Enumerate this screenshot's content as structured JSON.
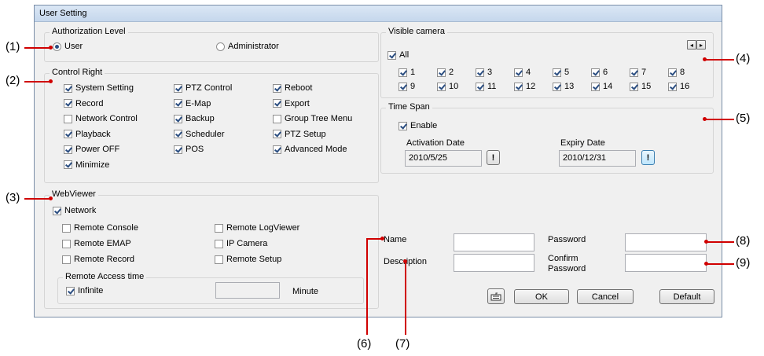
{
  "window": {
    "title": "User Setting"
  },
  "authorization": {
    "title": "Authorization Level",
    "options": [
      {
        "label": "User",
        "selected": true
      },
      {
        "label": "Administrator",
        "selected": false
      }
    ]
  },
  "control_right": {
    "title": "Control Right",
    "items": [
      {
        "label": "System Setting",
        "checked": true
      },
      {
        "label": "PTZ Control",
        "checked": true
      },
      {
        "label": "Reboot",
        "checked": true
      },
      {
        "label": "Record",
        "checked": true
      },
      {
        "label": "E-Map",
        "checked": true
      },
      {
        "label": "Export",
        "checked": true
      },
      {
        "label": "Network Control",
        "checked": false
      },
      {
        "label": "Backup",
        "checked": true
      },
      {
        "label": "Group Tree Menu",
        "checked": false
      },
      {
        "label": "Playback",
        "checked": true
      },
      {
        "label": "Scheduler",
        "checked": true
      },
      {
        "label": "PTZ Setup",
        "checked": true
      },
      {
        "label": "Power OFF",
        "checked": true
      },
      {
        "label": "POS",
        "checked": true
      },
      {
        "label": "Advanced Mode",
        "checked": true
      },
      {
        "label": "Minimize",
        "checked": true
      }
    ]
  },
  "webviewer": {
    "title": "WebViewer",
    "network": {
      "label": "Network",
      "checked": true
    },
    "items": [
      {
        "label": "Remote Console",
        "checked": false
      },
      {
        "label": "Remote LogViewer",
        "checked": false
      },
      {
        "label": "Remote EMAP",
        "checked": false
      },
      {
        "label": "IP Camera",
        "checked": false
      },
      {
        "label": "Remote Record",
        "checked": false
      },
      {
        "label": "Remote Setup",
        "checked": false
      }
    ],
    "access_time": {
      "title": "Remote Access time",
      "infinite": {
        "label": "Infinite",
        "checked": true
      },
      "minutes_value": "",
      "unit": "Minute"
    }
  },
  "visible_camera": {
    "title": "Visible camera",
    "all": {
      "label": "All",
      "checked": true
    },
    "cameras": [
      "1",
      "2",
      "3",
      "4",
      "5",
      "6",
      "7",
      "8",
      "9",
      "10",
      "11",
      "12",
      "13",
      "14",
      "15",
      "16"
    ],
    "scroll_left": "◂",
    "scroll_right": "▸"
  },
  "time_span": {
    "title": "Time Span",
    "enable": {
      "label": "Enable",
      "checked": true
    },
    "activation_label": "Activation Date",
    "activation_value": "2010/5/25",
    "expiry_label": "Expiry Date",
    "expiry_value": "2010/12/31",
    "picker_glyph": "!"
  },
  "account": {
    "name_label": "Name",
    "name_value": "",
    "password_label": "Password",
    "password_value": "",
    "description_label": "Description",
    "description_value": "",
    "confirm_label_1": "Confirm",
    "confirm_label_2": "Password",
    "confirm_value": ""
  },
  "buttons": {
    "ok": "OK",
    "cancel": "Cancel",
    "default": "Default"
  },
  "callouts": [
    "(1)",
    "(2)",
    "(3)",
    "(4)",
    "(5)",
    "(6)",
    "(7)",
    "(8)",
    "(9)"
  ],
  "colors": {
    "callout_line": "#d00000",
    "check": "#2a4d80"
  }
}
